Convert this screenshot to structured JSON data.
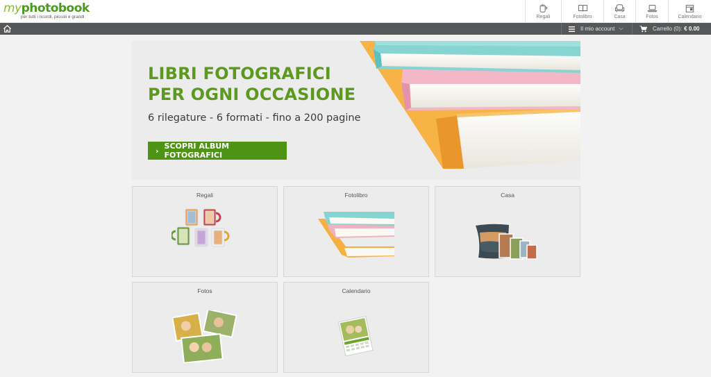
{
  "brand": {
    "logo_my": "my",
    "logo_main": "photobook",
    "tagline": "per tutti i ricordi, piccoli e grandi"
  },
  "topnav": [
    {
      "label": "Regali",
      "icon": "mug-icon"
    },
    {
      "label": "Fotolibro",
      "icon": "book-icon"
    },
    {
      "label": "Casa",
      "icon": "armchair-icon"
    },
    {
      "label": "Fotos",
      "icon": "laptop-icon"
    },
    {
      "label": "Calendario",
      "icon": "calendar-icon"
    }
  ],
  "account_bar": {
    "home_icon": "home-icon",
    "account_label": "Il mio account",
    "cart_label": "Carrello (0):",
    "cart_total": "€ 0.00"
  },
  "hero": {
    "title": "LIBRI FOTOGRAFICI\nPER OGNI OCCASIONE",
    "subtitle": "6 rilegature - 6 formati - fino a 200 pagine",
    "cta": "SCOPRI ALBUM FOTOGRAFICI"
  },
  "categories": [
    {
      "label": "Regali",
      "image": "mugs"
    },
    {
      "label": "Fotolibro",
      "image": "photobooks"
    },
    {
      "label": "Casa",
      "image": "pillow-and-canvases"
    },
    {
      "label": "Fotos",
      "image": "photo-prints"
    },
    {
      "label": "Calendario",
      "image": "wall-calendar"
    }
  ],
  "colors": {
    "brand_green": "#4e9313",
    "hero_title": "#5b9a1e",
    "dark_bar": "#555759",
    "page_bg": "#f2f2f2"
  }
}
